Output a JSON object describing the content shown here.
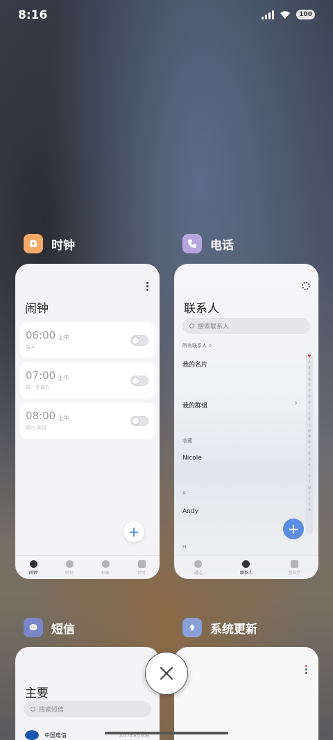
{
  "status_bar": {
    "time": "8:16",
    "battery": "100"
  },
  "apps": [
    {
      "name": "时钟",
      "icon_color": "#f4a968",
      "card": {
        "title": "闹钟",
        "alarms": [
          {
            "time": "06:00",
            "suffix": "上午",
            "repeat": "每天"
          },
          {
            "time": "07:00",
            "suffix": "上午",
            "repeat": "周一至周五"
          },
          {
            "time": "08:00",
            "suffix": "上午",
            "repeat": "周六 周日"
          }
        ],
        "nav": [
          "闹钟",
          "时钟",
          "秒表",
          "计时"
        ]
      }
    },
    {
      "name": "电话",
      "icon_color": "#b9a6de",
      "card": {
        "title": "联系人",
        "search_placeholder": "搜索联系人",
        "all_contacts": "所有联系人 ≎",
        "my_card": "我的名片",
        "my_groups": "我的群组",
        "favorites": "收藏",
        "contact1": "Nicole",
        "section_a": "A",
        "contact2": "Andy",
        "section_h": "H",
        "index_letters": [
          "♥",
          "A",
          "B",
          "C",
          "D",
          "E",
          "F",
          "G",
          "H",
          "I",
          "J",
          "K",
          "L",
          "M",
          "N",
          "O",
          "P",
          "Q",
          "R",
          "S",
          "T",
          "U",
          "V",
          "W",
          "X",
          "Y",
          "Z",
          "#"
        ],
        "nav": [
          "通话",
          "联系人",
          "营业厅"
        ]
      }
    },
    {
      "name": "短信",
      "icon_color": "#7a86c8",
      "card": {
        "title": "主要",
        "search_placeholder": "搜索短信",
        "sender": "中国电信",
        "date": "2017年6月30日"
      }
    },
    {
      "name": "系统更新",
      "icon_color": "#8a9fd8"
    }
  ],
  "accent": "#3b82d6"
}
